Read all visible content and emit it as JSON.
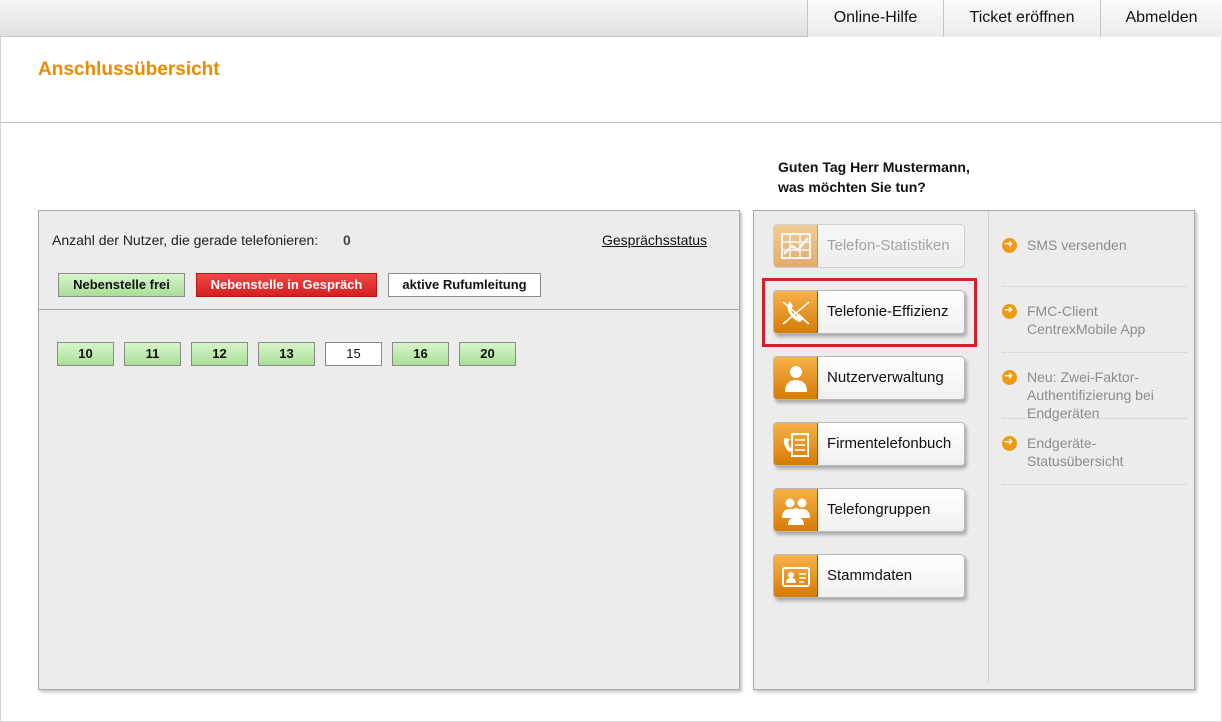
{
  "topbar": {
    "help": "Online-Hilfe",
    "ticket": "Ticket eröffnen",
    "logout": "Abmelden"
  },
  "page": {
    "title": "Anschlussübersicht",
    "greeting_line1": "Guten Tag Herr Mustermann,",
    "greeting_line2": "was möchten Sie tun?"
  },
  "status_panel": {
    "count_label": "Anzahl der Nutzer, die gerade telefonieren:",
    "count_value": "0",
    "status_link": "Gesprächsstatus",
    "legend": {
      "free": "Nebenstelle frei",
      "busy": "Nebenstelle in Gespräch",
      "forward": "aktive Rufumleitung"
    },
    "extensions": [
      {
        "number": "10",
        "state": "free"
      },
      {
        "number": "11",
        "state": "free"
      },
      {
        "number": "12",
        "state": "free"
      },
      {
        "number": "13",
        "state": "free"
      },
      {
        "number": "15",
        "state": "forward"
      },
      {
        "number": "16",
        "state": "free"
      },
      {
        "number": "20",
        "state": "free"
      }
    ]
  },
  "actions": [
    {
      "label": "Telefon-Statistiken",
      "icon": "statistics-icon",
      "enabled": false
    },
    {
      "label": "Telefonie-Effizienz",
      "icon": "phone-efficiency-icon",
      "enabled": true,
      "highlighted": true
    },
    {
      "label": "Nutzerverwaltung",
      "icon": "user-icon",
      "enabled": true
    },
    {
      "label": "Firmentelefonbuch",
      "icon": "phonebook-icon",
      "enabled": true
    },
    {
      "label": "Telefongruppen",
      "icon": "group-icon",
      "enabled": true
    },
    {
      "label": "Stammdaten",
      "icon": "id-card-icon",
      "enabled": true
    }
  ],
  "side_links": [
    {
      "text": "SMS versenden"
    },
    {
      "text": "FMC-Client CentrexMobile App"
    },
    {
      "text": "Neu: Zwei-Faktor-Authentifizierung bei Endgeräten"
    },
    {
      "text": "Endgeräte-Statusübersicht"
    }
  ],
  "colors": {
    "accent": "#ee8a00",
    "free": "#a9de96",
    "busy": "#d61f1f",
    "highlight": "#d4202a"
  }
}
